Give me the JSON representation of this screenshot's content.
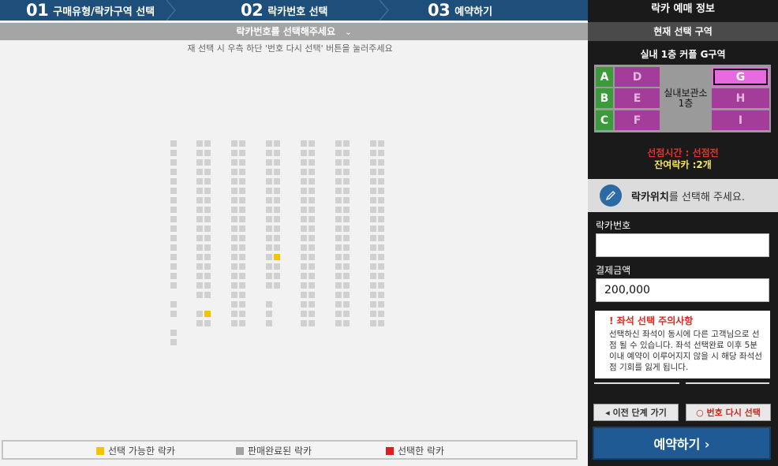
{
  "steps": [
    {
      "num": "01",
      "label": "구매유형/락카구역 선택"
    },
    {
      "num": "02",
      "label": "락카번호 선택"
    },
    {
      "num": "03",
      "label": "예약하기"
    }
  ],
  "prompt": {
    "label": "락카번호를 선택해주세요",
    "icon": "chevron-down-icon"
  },
  "hint": "재 선택 시 우측 하단 '번호 다시 선택' 버튼을 눌러주세요",
  "legend": [
    {
      "label": "선택 가능한 락카",
      "color": "#f5c400"
    },
    {
      "label": "판매완료된 락카",
      "color": "#a3a3a3"
    },
    {
      "label": "선택한 락카",
      "color": "#e01e1e"
    }
  ],
  "seat_colors": {
    "sold": "#d0d0d0",
    "available": "#f5c400"
  },
  "panel": {
    "title": "락카 예매 정보",
    "zone_header": "현재 선택 구역",
    "zone_selected": "실내 1층 커플 G구역",
    "zone_map": {
      "rows": [
        "A",
        "B",
        "C"
      ],
      "left": [
        "D",
        "E",
        "F"
      ],
      "right": [
        "G",
        "H",
        "I"
      ],
      "center": [
        "실내보관소",
        "1층"
      ],
      "active": "G"
    },
    "time_line": "선점시간 : 선점전",
    "remain_line": "잔여락카 :2개",
    "location_prompt_bold": "락카위치",
    "location_prompt_rest": "를 선택해 주세요.",
    "location_icon": "pencil-icon",
    "locker_number_label": "락카번호",
    "locker_number_value": "",
    "amount_label": "결제금액",
    "amount_value": "200,000",
    "notice_title": "! 좌석 선택 주의사항",
    "notice_body": "선택하신 좌석이 동시에 다른 고객님으로 선점 될 수 있습니다. 좌석 선택완료 이후 5분 이내 예약이 이루어지지 않을 시 해당 좌석선점 기회를 잃게 됩니다.",
    "prev_button": "◂ 이전 단계 가기",
    "reselect_button": "○ 번호 다시 선택",
    "reserve_button": "예약하기 ›"
  }
}
